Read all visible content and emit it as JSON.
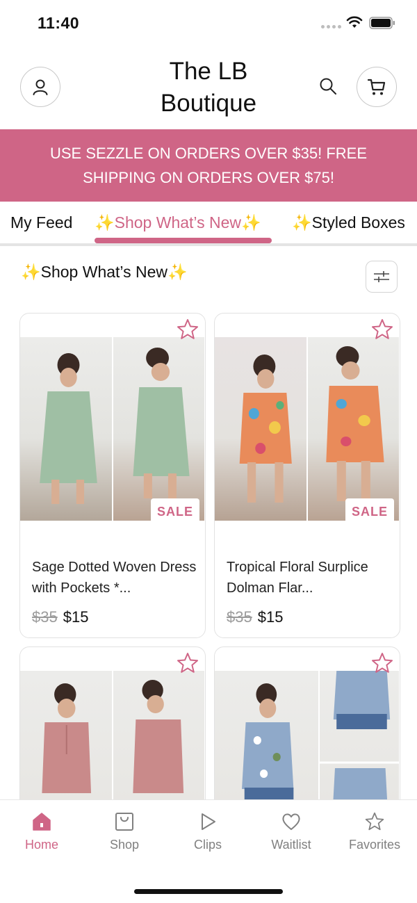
{
  "status_bar": {
    "time": "11:40"
  },
  "header": {
    "title": "The LB Boutique",
    "account_icon": "person-icon",
    "search_icon": "search-icon",
    "cart_icon": "cart-icon"
  },
  "promo": {
    "text": "USE SEZZLE ON ORDERS OVER $35! FREE SHIPPING ON ORDERS OVER $75!"
  },
  "tabs": [
    {
      "label": "My Feed",
      "active": false
    },
    {
      "label": "✨Shop What’s New✨",
      "active": true
    },
    {
      "label": "✨Styled Boxes"
    }
  ],
  "section": {
    "title": "✨Shop What’s New✨",
    "filter_icon": "sliders-icon"
  },
  "products": [
    {
      "name": "Sage Dotted Woven Dress with Pockets *...",
      "old_price": "$35",
      "price": "$15",
      "badge": "SALE",
      "color": "#9fbfa4"
    },
    {
      "name": "Tropical Floral Surplice Dolman Flar...",
      "old_price": "$35",
      "price": "$15",
      "badge": "SALE",
      "color": "#e98b5a"
    },
    {
      "color": "#c98a8a"
    },
    {
      "color": "#8fa9c9"
    }
  ],
  "nav": [
    {
      "label": "Home",
      "icon": "home-icon",
      "active": true
    },
    {
      "label": "Shop",
      "icon": "shopping-bag-icon"
    },
    {
      "label": "Clips",
      "icon": "play-icon"
    },
    {
      "label": "Waitlist",
      "icon": "heart-icon"
    },
    {
      "label": "Favorites",
      "icon": "star-icon"
    }
  ],
  "colors": {
    "accent": "#cf6586",
    "border": "#e2e2e2",
    "muted": "#808080"
  }
}
